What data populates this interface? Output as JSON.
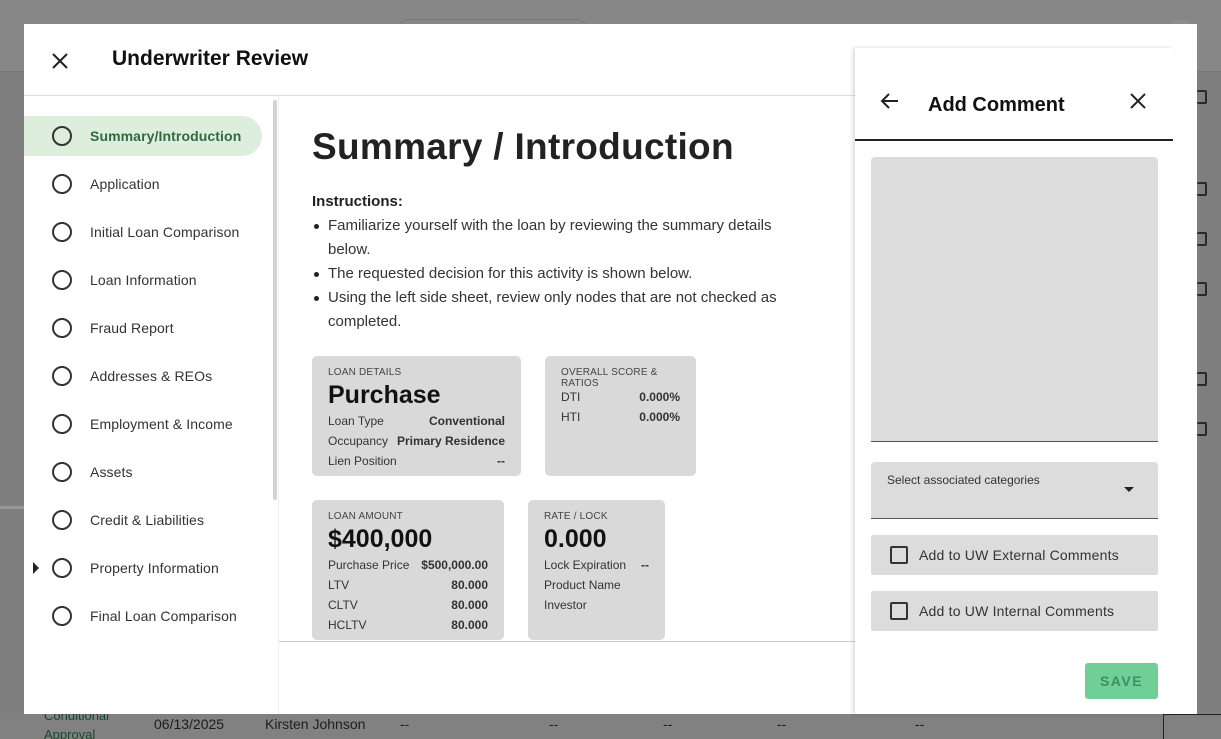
{
  "background": {
    "row": {
      "status": "Conditional Approval",
      "date": "06/13/2025",
      "name": "Kirsten Johnson",
      "cells": [
        "--",
        "--",
        "--",
        "--",
        "--"
      ]
    }
  },
  "modal": {
    "title": "Underwriter Review",
    "close_icon": "close-icon"
  },
  "nav": {
    "items": [
      {
        "label": "Summary/Introduction",
        "active": true
      },
      {
        "label": "Application"
      },
      {
        "label": "Initial Loan Comparison"
      },
      {
        "label": "Loan Information"
      },
      {
        "label": "Fraud Report"
      },
      {
        "label": "Addresses & REOs"
      },
      {
        "label": "Employment & Income"
      },
      {
        "label": "Assets"
      },
      {
        "label": "Credit & Liabilities"
      },
      {
        "label": "Property Information",
        "expandable": true
      },
      {
        "label": "Final Loan Comparison"
      }
    ]
  },
  "main": {
    "title": "Summary / Introduction",
    "instructions_heading": "Instructions:",
    "instructions": [
      "Familiarize yourself with the loan by reviewing the summary details below.",
      "The requested decision for this activity is shown below.",
      "Using the left side sheet, review only nodes that are not checked as completed."
    ],
    "loan_details": {
      "caption": "LOAN DETAILS",
      "value": "Purchase",
      "rows": [
        {
          "label": "Loan Type",
          "value": "Conventional"
        },
        {
          "label": "Occupancy",
          "value": "Primary Residence"
        },
        {
          "label": "Lien Position",
          "value": "--"
        }
      ]
    },
    "scores": {
      "caption": "OVERALL SCORE & RATIOS",
      "rows": [
        {
          "label": "DTI",
          "value": "0.000%"
        },
        {
          "label": "HTI",
          "value": "0.000%"
        }
      ]
    },
    "loan_amount": {
      "caption": "LOAN AMOUNT",
      "value": "$400,000",
      "rows": [
        {
          "label": "Purchase Price",
          "value": "$500,000.00"
        },
        {
          "label": "LTV",
          "value": "80.000"
        },
        {
          "label": "CLTV",
          "value": "80.000"
        },
        {
          "label": "HCLTV",
          "value": "80.000"
        }
      ]
    },
    "rate_lock": {
      "caption": "RATE / LOCK",
      "value": "0.000",
      "rows": [
        {
          "label": "Lock Expiration",
          "value": "--"
        },
        {
          "label": "Product Name",
          "value": ""
        },
        {
          "label": "Investor",
          "value": ""
        }
      ]
    }
  },
  "comment_panel": {
    "title": "Add Comment",
    "text_value": "",
    "categories_placeholder": "Select associated categories",
    "external_label": "Add to UW External Comments",
    "internal_label": "Add to UW Internal Comments",
    "save_label": "SAVE",
    "colors": {
      "save_bg": "#6fcf97",
      "save_text": "#3f8e60",
      "active_nav_bg": "#ddeedd"
    }
  }
}
